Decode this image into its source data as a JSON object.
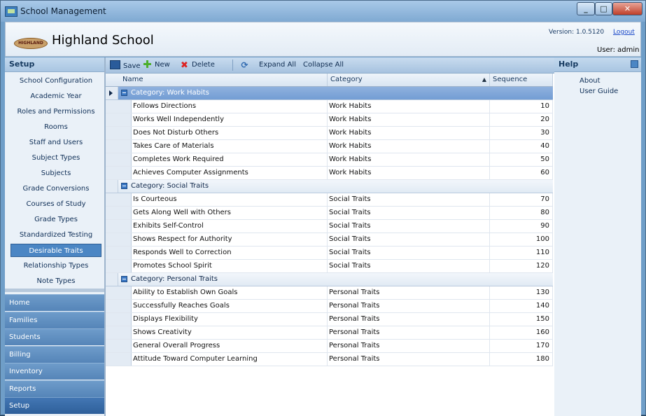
{
  "window": {
    "title": "School Management"
  },
  "header": {
    "school_name": "Highland School",
    "logo_text": "HIGHLAND",
    "version": "Version: 1.0.5120",
    "logout": "Logout",
    "user": "User: admin"
  },
  "nav": {
    "section_title": "Setup",
    "items": [
      {
        "label": "School Configuration"
      },
      {
        "label": "Academic Year"
      },
      {
        "label": "Roles and Permissions"
      },
      {
        "label": "Rooms"
      },
      {
        "label": "Staff and Users"
      },
      {
        "label": "Subject Types"
      },
      {
        "label": "Subjects"
      },
      {
        "label": "Grade Conversions"
      },
      {
        "label": "Courses of Study"
      },
      {
        "label": "Grade Types"
      },
      {
        "label": "Standardized Testing"
      },
      {
        "label": "Desirable Traits",
        "selected": true
      },
      {
        "label": "Relationship Types"
      },
      {
        "label": "Note Types"
      }
    ],
    "modules": [
      {
        "label": "Home"
      },
      {
        "label": "Families"
      },
      {
        "label": "Students"
      },
      {
        "label": "Billing"
      },
      {
        "label": "Inventory"
      },
      {
        "label": "Reports"
      },
      {
        "label": "Setup",
        "active": true
      }
    ]
  },
  "toolbar": {
    "save": "Save",
    "new": "New",
    "delete": "Delete",
    "expand_all": "Expand All",
    "collapse_all": "Collapse All"
  },
  "grid": {
    "columns": {
      "name": "Name",
      "category": "Category",
      "sequence": "Sequence"
    },
    "groups": [
      {
        "label": "Category: Work Habits",
        "selected": true,
        "rows": [
          {
            "name": "Follows Directions",
            "category": "Work Habits",
            "sequence": "10"
          },
          {
            "name": "Works Well Independently",
            "category": "Work Habits",
            "sequence": "20"
          },
          {
            "name": "Does Not Disturb Others",
            "category": "Work Habits",
            "sequence": "30"
          },
          {
            "name": "Takes Care of Materials",
            "category": "Work Habits",
            "sequence": "40"
          },
          {
            "name": "Completes Work Required",
            "category": "Work Habits",
            "sequence": "50"
          },
          {
            "name": "Achieves Computer Assignments",
            "category": "Work Habits",
            "sequence": "60"
          }
        ]
      },
      {
        "label": "Category: Social Traits",
        "rows": [
          {
            "name": "Is Courteous",
            "category": "Social Traits",
            "sequence": "70"
          },
          {
            "name": "Gets Along Well with Others",
            "category": "Social Traits",
            "sequence": "80"
          },
          {
            "name": "Exhibits Self-Control",
            "category": "Social Traits",
            "sequence": "90"
          },
          {
            "name": "Shows Respect for Authority",
            "category": "Social Traits",
            "sequence": "100"
          },
          {
            "name": "Responds Well to Correction",
            "category": "Social Traits",
            "sequence": "110"
          },
          {
            "name": "Promotes School Spirit",
            "category": "Social Traits",
            "sequence": "120"
          }
        ]
      },
      {
        "label": "Category: Personal Traits",
        "rows": [
          {
            "name": "Ability to Establish Own Goals",
            "category": "Personal Traits",
            "sequence": "130"
          },
          {
            "name": "Successfully Reaches Goals",
            "category": "Personal Traits",
            "sequence": "140"
          },
          {
            "name": "Displays Flexibility",
            "category": "Personal Traits",
            "sequence": "150"
          },
          {
            "name": "Shows Creativity",
            "category": "Personal Traits",
            "sequence": "160"
          },
          {
            "name": "General Overall Progress",
            "category": "Personal Traits",
            "sequence": "170"
          },
          {
            "name": "Attitude Toward Computer Learning",
            "category": "Personal Traits",
            "sequence": "180"
          }
        ]
      }
    ]
  },
  "help": {
    "title": "Help",
    "links": [
      {
        "label": "About"
      },
      {
        "label": "User Guide"
      }
    ]
  }
}
